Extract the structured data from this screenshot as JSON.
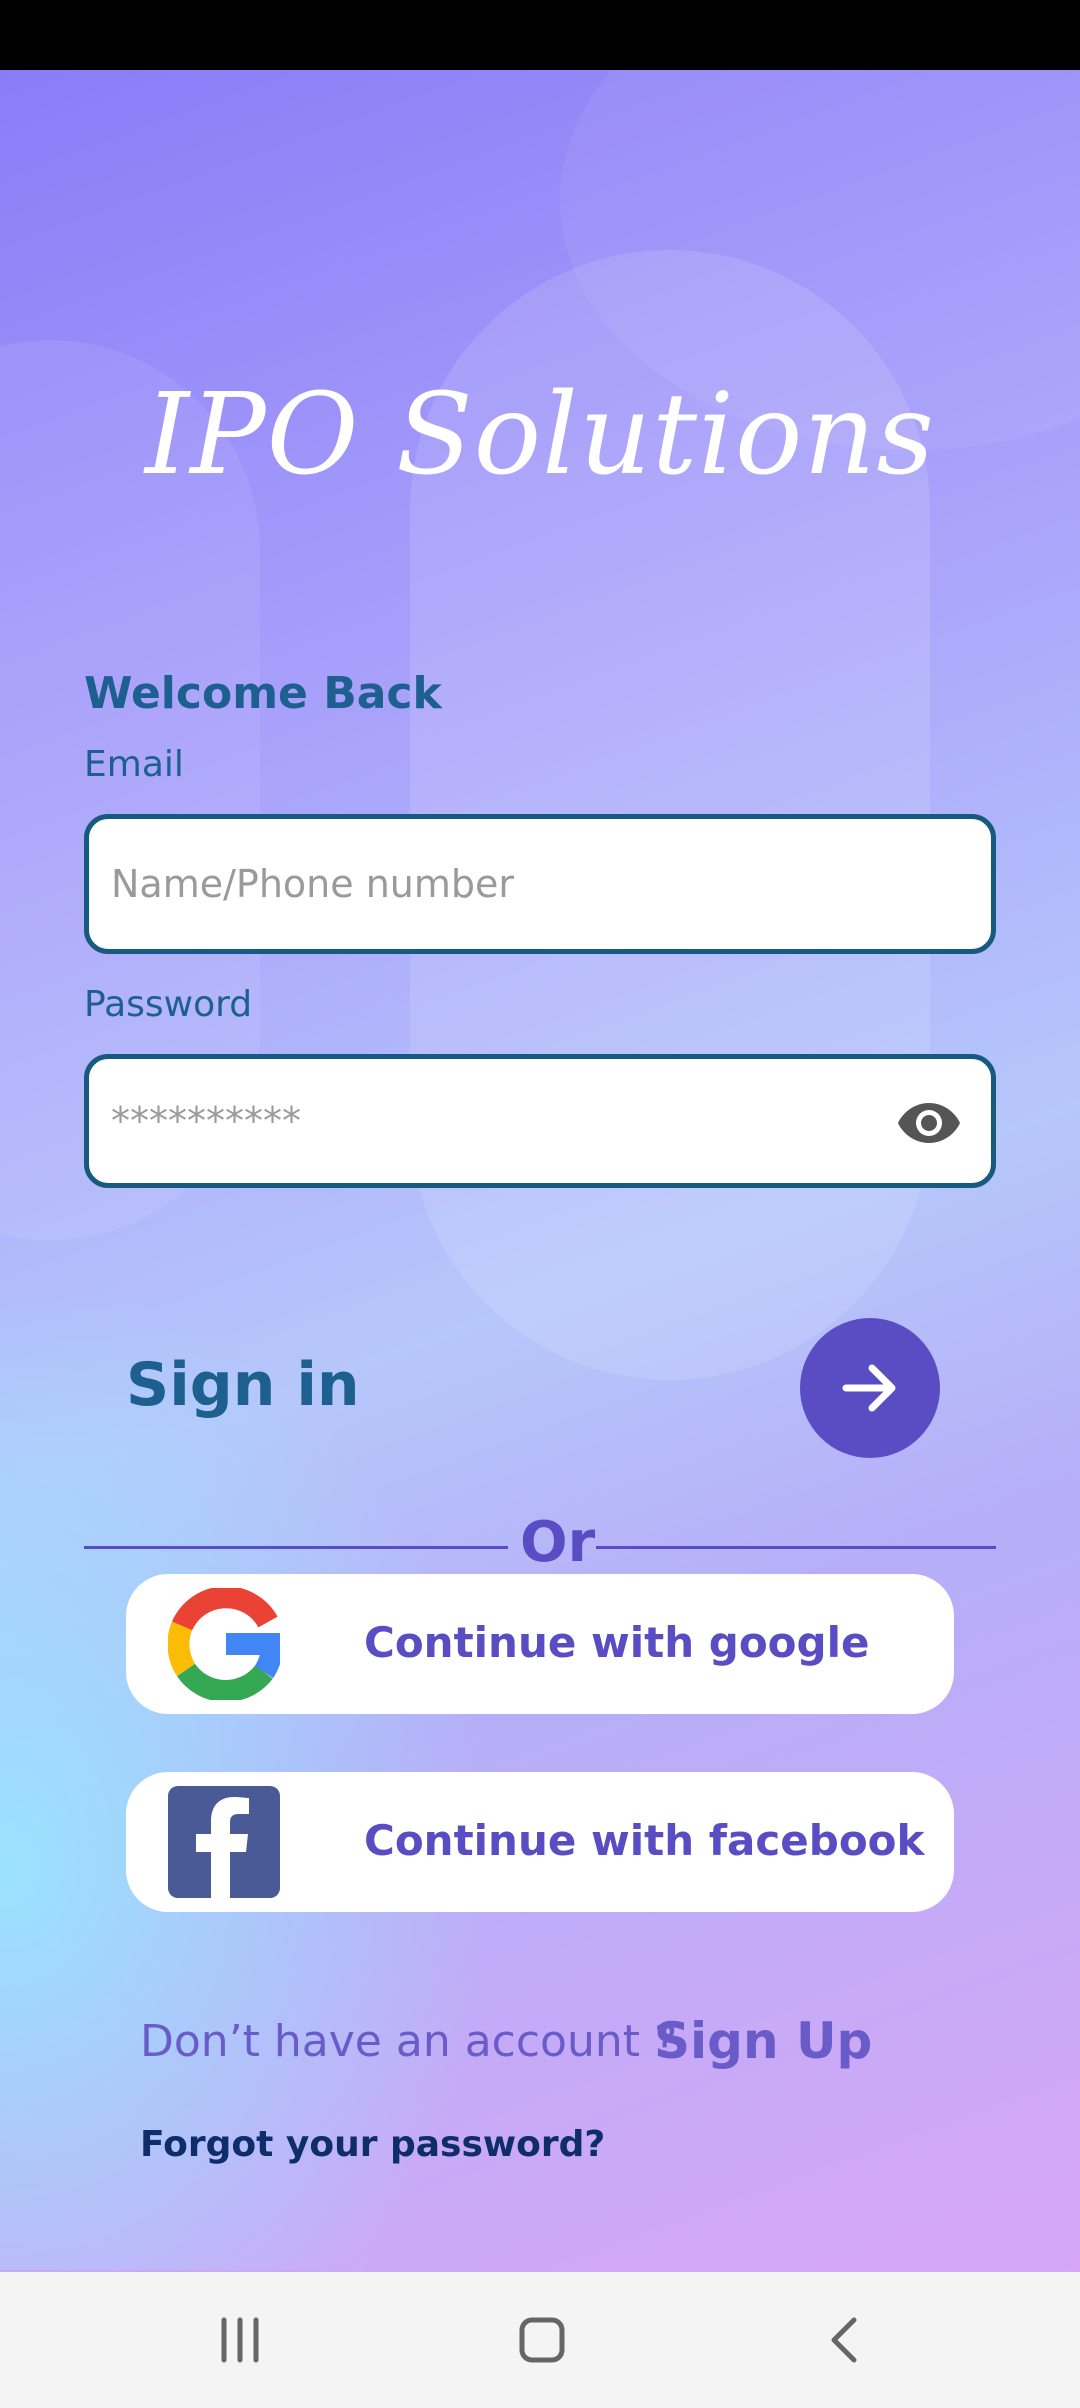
{
  "app": {
    "title": "IPO Solutions"
  },
  "login": {
    "welcome": "Welcome Back",
    "email_label": "Email",
    "email_placeholder": "Name/Phone number",
    "password_label": "Password",
    "password_placeholder": "**********",
    "sign_in_label": "Sign in"
  },
  "divider": {
    "text": "Or"
  },
  "social": {
    "google_label": "Continue with google",
    "facebook_label": "Continue with facebook"
  },
  "footer": {
    "signup_prompt": "Don’t have an account ?",
    "signup_link": "Sign Up",
    "forgot_password": "Forgot your password?"
  },
  "colors": {
    "accent": "#5a4cc3",
    "text_blue": "#1d5f8e",
    "field_border": "#175a7f",
    "facebook_blue": "#4a5a96"
  },
  "icons": [
    "eye-icon",
    "arrow-right-icon",
    "google-icon",
    "facebook-icon",
    "recent-apps-icon",
    "home-icon",
    "back-icon"
  ]
}
